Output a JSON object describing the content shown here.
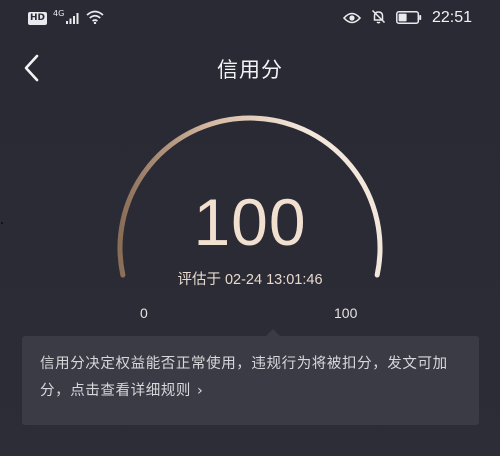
{
  "status_bar": {
    "hd_badge": "HD",
    "network_type": "4G",
    "time": "22:51",
    "icons": [
      "signal-icon",
      "wifi-icon",
      "eye-icon",
      "bell-off-icon",
      "battery-icon"
    ]
  },
  "header": {
    "title": "信用分",
    "back_icon": "chevron-left-icon"
  },
  "gauge": {
    "score": "100",
    "eval_prefix": "评估于",
    "eval_time": "02-24 13:01:46",
    "min_label": "0",
    "max_label": "100",
    "score_fraction": 1.0,
    "colors": {
      "arc_start": "#8a6d57",
      "arc_mid": "#d6b9a2",
      "arc_end": "#f3e6da"
    }
  },
  "tip": {
    "text": "信用分决定权益能否正常使用，违规行为将被扣分，发文可加分，点击查看详细规则",
    "chevron_icon": "chevron-right-icon"
  },
  "colors": {
    "background": "#2a2a33",
    "card": "#3b3b45",
    "score_text": "#f1dfcf"
  }
}
